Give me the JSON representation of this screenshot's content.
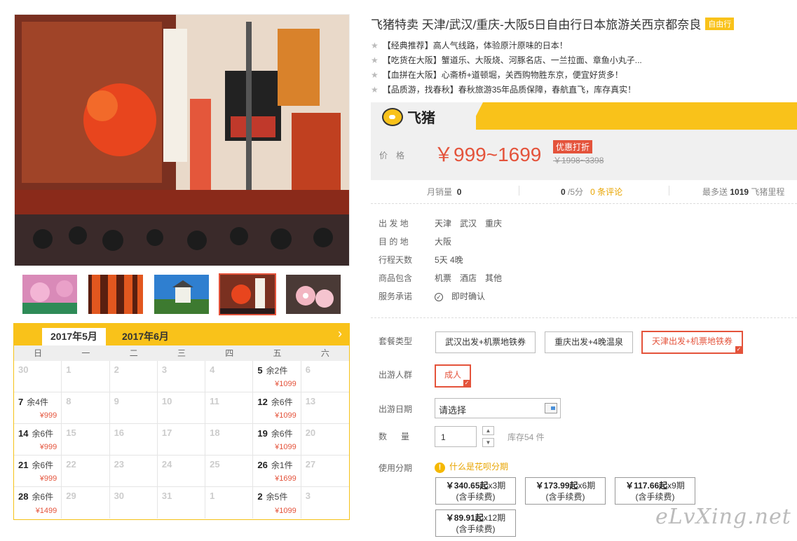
{
  "product": {
    "title": "飞猪特卖 天津/武汉/重庆-大阪5日自由行日本旅游关西京都奈良",
    "tag": "自由行",
    "highlights": [
      "【经典推荐】高人气线路，体验原汁原味的日本！",
      "【吃货在大阪】蟹道乐、大阪烧、河豚名店、一兰拉面、章鱼小丸子...",
      "【血拼在大阪】心斋桥+道顿堀，关西购物胜东京，便宜好货多！",
      "【品质游，找春秋】春秋旅游35年品质保障，春航直飞，库存真实！"
    ]
  },
  "brand": {
    "name": "飞猪",
    "accent": "#f9c21a"
  },
  "price": {
    "label": "价格",
    "current": "￥999~1699",
    "promo": "优惠打折",
    "original": "￥1998~3398",
    "color": "#e4533b"
  },
  "stats": {
    "monthly_sales_label": "月销量",
    "monthly_sales": "0",
    "rating": "0",
    "rating_suffix": "/5分",
    "reviews": "0 条评论",
    "miles_prefix": "最多送",
    "miles": "1019",
    "miles_suffix": "飞猪里程"
  },
  "info": [
    {
      "label": "出 发 地",
      "values": [
        "天津",
        "武汉",
        "重庆"
      ]
    },
    {
      "label": "目 的 地",
      "values": [
        "大阪"
      ]
    },
    {
      "label": "行程天数",
      "values": [
        "5天 4晚"
      ]
    },
    {
      "label": "商品包含",
      "values": [
        "机票",
        "酒店",
        "其他"
      ]
    },
    {
      "label": "服务承诺",
      "values": [
        "即时确认"
      ]
    }
  ],
  "options": {
    "package_label": "套餐类型",
    "packages": [
      "武汉出发+机票地铁券",
      "重庆出发+4晚温泉",
      "天津出发+机票地铁券"
    ],
    "group_label": "出游人群",
    "group": "成人",
    "date_label": "出游日期",
    "date_placeholder": "请选择",
    "qty_label": "数    量",
    "qty": "1",
    "stock": "库存54 件",
    "installment_label": "使用分期",
    "huabei_link": "什么是花呗分期"
  },
  "installments": [
    {
      "amount": "￥340.65起",
      "period": "x3期",
      "note": "(含手续费)"
    },
    {
      "amount": "￥173.99起",
      "period": "x6期",
      "note": "(含手续费)"
    },
    {
      "amount": "￥117.66起",
      "period": "x9期",
      "note": "(含手续费)"
    },
    {
      "amount": "￥89.91起",
      "period": "x12期",
      "note": "(含手续费)"
    }
  ],
  "calendar": {
    "months": [
      "2017年5月",
      "2017年6月"
    ],
    "next_icon": "chevron-right-icon",
    "weekdays": [
      "日",
      "一",
      "二",
      "三",
      "四",
      "五",
      "六"
    ],
    "cells": [
      {
        "d": "30"
      },
      {
        "d": "1"
      },
      {
        "d": "2"
      },
      {
        "d": "3"
      },
      {
        "d": "4"
      },
      {
        "d": "5",
        "left": "余2件",
        "price": "¥1099"
      },
      {
        "d": "6"
      },
      {
        "d": "7",
        "left": "余4件",
        "price": "¥999"
      },
      {
        "d": "8"
      },
      {
        "d": "9"
      },
      {
        "d": "10"
      },
      {
        "d": "11"
      },
      {
        "d": "12",
        "left": "余6件",
        "price": "¥1099"
      },
      {
        "d": "13"
      },
      {
        "d": "14",
        "left": "余6件",
        "price": "¥999"
      },
      {
        "d": "15"
      },
      {
        "d": "16"
      },
      {
        "d": "17"
      },
      {
        "d": "18"
      },
      {
        "d": "19",
        "left": "余6件",
        "price": "¥1099"
      },
      {
        "d": "20"
      },
      {
        "d": "21",
        "left": "余6件",
        "price": "¥999"
      },
      {
        "d": "22"
      },
      {
        "d": "23"
      },
      {
        "d": "24"
      },
      {
        "d": "25"
      },
      {
        "d": "26",
        "left": "余1件",
        "price": "¥1699"
      },
      {
        "d": "27"
      },
      {
        "d": "28",
        "left": "余6件",
        "price": "¥1499"
      },
      {
        "d": "29"
      },
      {
        "d": "30"
      },
      {
        "d": "31"
      },
      {
        "d": "1"
      },
      {
        "d": "2",
        "left": "余5件",
        "price": "¥1099"
      },
      {
        "d": "3"
      }
    ]
  },
  "watermark": "eLvXing.net"
}
